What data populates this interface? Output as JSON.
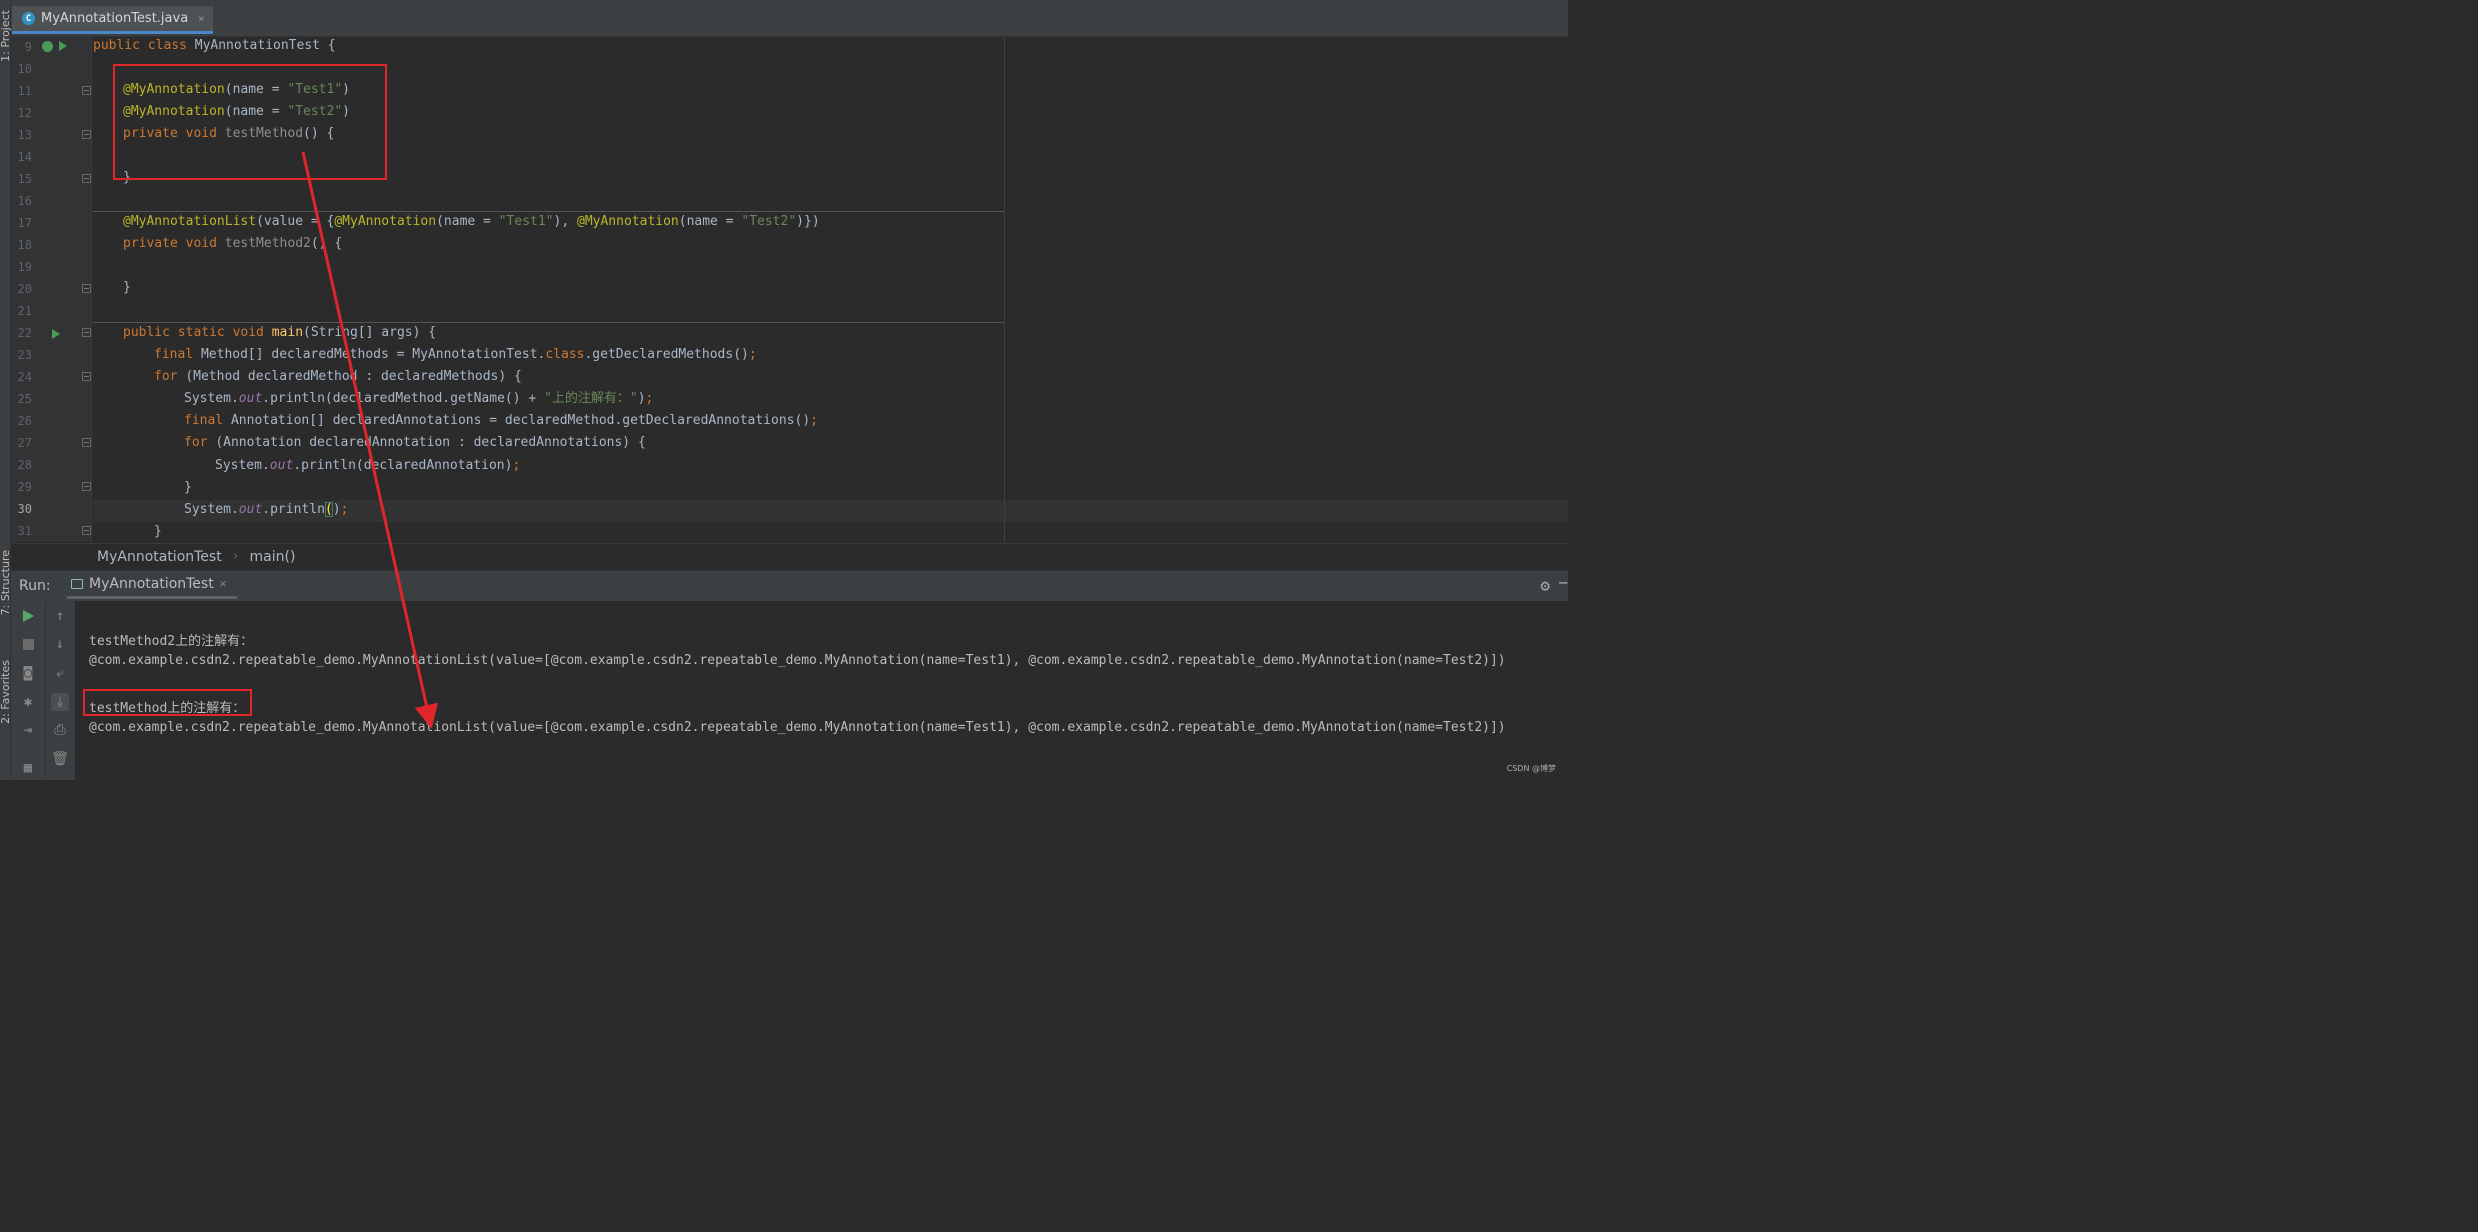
{
  "sidebar": {
    "project_label": "1: Project",
    "structure_label": "7: Structure",
    "favorites_label": "2: Favorites"
  },
  "tab": {
    "label": "MyAnnotationTest.java",
    "close": "×",
    "icon_letter": "C"
  },
  "editor": {
    "line_numbers": [
      "9",
      "10",
      "11",
      "12",
      "13",
      "14",
      "15",
      "16",
      "17",
      "18",
      "19",
      "20",
      "21",
      "22",
      "23",
      "24",
      "25",
      "26",
      "27",
      "28",
      "29",
      "30",
      "31"
    ],
    "current_line": "30",
    "lines": {
      "l9": [
        "public class ",
        "MyAnnotationTest {"
      ],
      "l11": [
        "@MyAnnotation",
        "(name = ",
        "\"Test1\"",
        ")"
      ],
      "l12": [
        "@MyAnnotation",
        "(name = ",
        "\"Test2\"",
        ")"
      ],
      "l13": [
        "private void ",
        "testMethod",
        "() {"
      ],
      "l15": [
        "}"
      ],
      "l17": [
        "@MyAnnotationList",
        "(value = {",
        "@MyAnnotation",
        "(name = ",
        "\"Test1\"",
        "), ",
        "@MyAnnotation",
        "(name = ",
        "\"Test2\"",
        ")})"
      ],
      "l18": [
        "private void ",
        "testMethod2",
        "() {"
      ],
      "l20": [
        "}"
      ],
      "l22": [
        "public static void ",
        "main",
        "(String[] args) {"
      ],
      "l23": [
        "final ",
        "Method[] declaredMethods = MyAnnotationTest.",
        "class",
        ".getDeclaredMethods()",
        ";"
      ],
      "l24": [
        "for ",
        "(Method declaredMethod : declaredMethods) {"
      ],
      "l25": [
        "System.",
        "out",
        ".println(declaredMethod.getName() + ",
        "\"上的注解有：\"",
        ")",
        ";"
      ],
      "l26": [
        "final ",
        "Annotation[] declaredAnnotations = declaredMethod.getDeclaredAnnotations()",
        ";"
      ],
      "l27": [
        "for ",
        "(Annotation declaredAnnotation : declaredAnnotations) {"
      ],
      "l28": [
        "System.",
        "out",
        ".println(declaredAnnotation)",
        ";"
      ],
      "l29": [
        "}"
      ],
      "l30": [
        "System.",
        "out",
        ".println",
        "(",
        ")",
        ";"
      ],
      "l31": [
        "}"
      ]
    }
  },
  "breadcrumb": {
    "class": "MyAnnotationTest",
    "method": "main()",
    "separator": "›"
  },
  "run_panel": {
    "title": "Run:",
    "tab_label": "MyAnnotationTest",
    "tab_close": "×",
    "settings_icon": "gear-icon",
    "output": [
      "testMethod2上的注解有：",
      "@com.example.csdn2.repeatable_demo.MyAnnotationList(value=[@com.example.csdn2.repeatable_demo.MyAnnotation(name=Test1), @com.example.csdn2.repeatable_demo.MyAnnotation(name=Test2)])",
      "testMethod上的注解有：",
      "@com.example.csdn2.repeatable_demo.MyAnnotationList(value=[@com.example.csdn2.repeatable_demo.MyAnnotation(name=Test1), @com.example.csdn2.repeatable_demo.MyAnnotation(name=Test2)])"
    ]
  },
  "watermark": "CSDN @博梦",
  "colors": {
    "keyword": "#cc7832",
    "annotation": "#bbb529",
    "string": "#6a8759",
    "method": "#ffc66d",
    "highlight": "#e0262a"
  }
}
